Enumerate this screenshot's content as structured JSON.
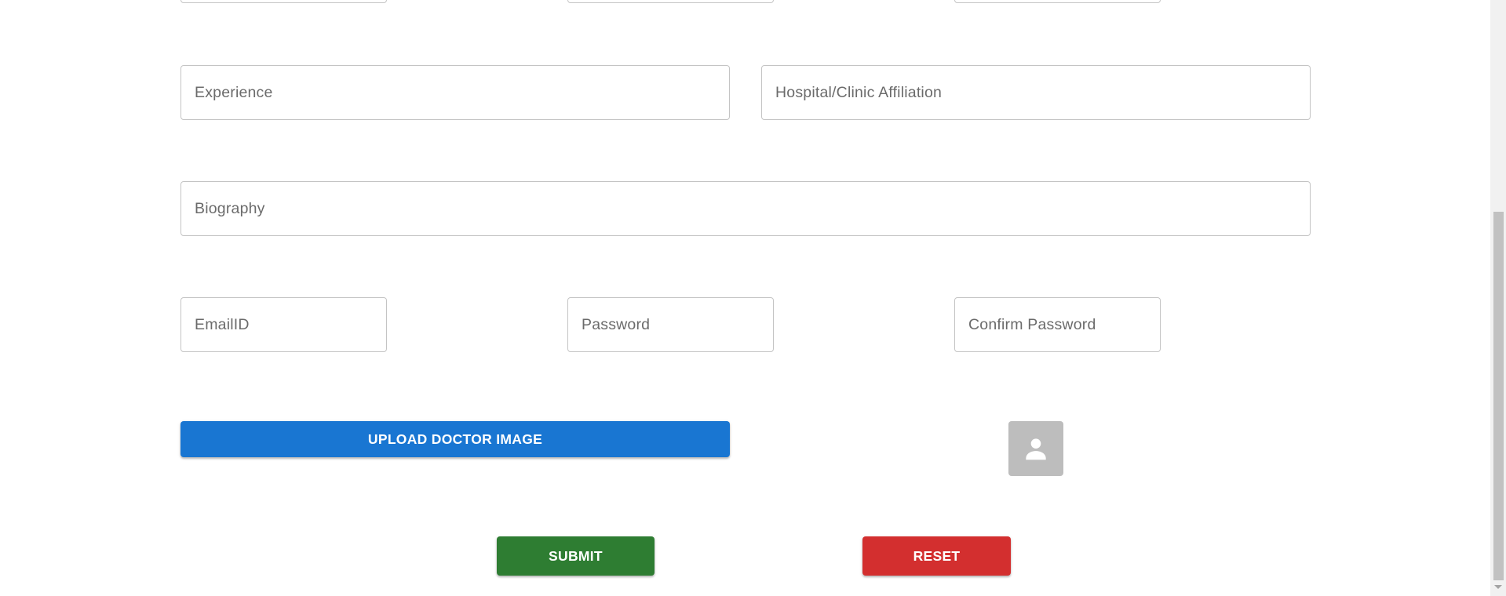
{
  "form": {
    "experience_placeholder": "Experience",
    "hospital_placeholder": "Hospital/Clinic Affiliation",
    "biography_placeholder": "Biography",
    "email_placeholder": "EmailID",
    "password_placeholder": "Password",
    "confirm_password_placeholder": "Confirm Password"
  },
  "buttons": {
    "upload_label": "UPLOAD DOCTOR IMAGE",
    "submit_label": "SUBMIT",
    "reset_label": "RESET"
  },
  "colors": {
    "upload": "#1976d2",
    "submit": "#2e7d32",
    "reset": "#d32f2f",
    "avatar_bg": "#bdbdbd"
  },
  "icons": {
    "avatar": "person-icon"
  }
}
